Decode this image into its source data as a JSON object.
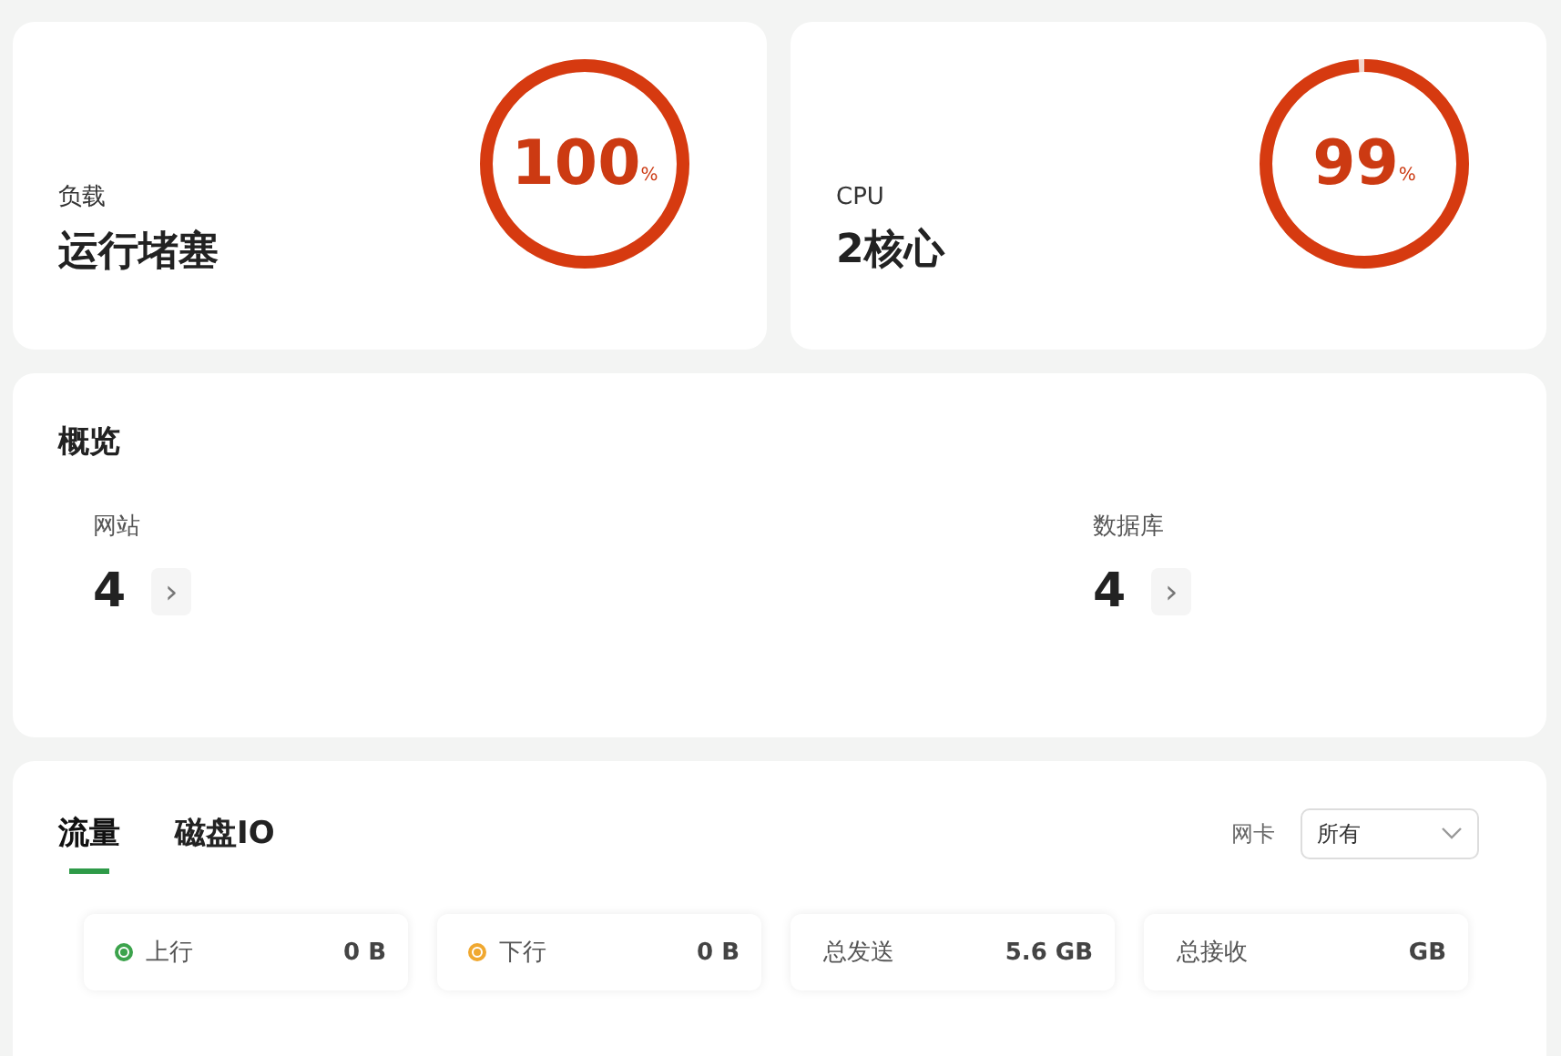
{
  "stat_cards": [
    {
      "label": "负载",
      "value": "运行堵塞",
      "gauge": {
        "number": "100",
        "unit": "%",
        "level": 1.0
      }
    },
    {
      "label": "CPU",
      "value": "2核心",
      "gauge": {
        "number": "99",
        "unit": "%",
        "level": 0.99
      }
    }
  ],
  "overview": {
    "title": "概览",
    "items": [
      {
        "label": "网站",
        "count": "4",
        "arrow": "›"
      },
      {
        "label": "数据库",
        "count": "4",
        "arrow": "›"
      }
    ]
  },
  "traffic": {
    "tabs": [
      {
        "label": "流量",
        "selected": true
      },
      {
        "label": "磁盘IO",
        "selected": false
      }
    ],
    "nic": {
      "label": "网卡",
      "value": "所有"
    },
    "stats": [
      {
        "kind": "dot",
        "label": "上行",
        "value": "0 B",
        "color": "#3ca34c"
      },
      {
        "kind": "dot",
        "label": "下行",
        "value": "0 B",
        "color": "#f0a830"
      },
      {
        "kind": "plain",
        "label": "总发送",
        "value": "5.6 GB"
      },
      {
        "kind": "plain",
        "label": "总接收",
        "value": "GB"
      }
    ]
  }
}
